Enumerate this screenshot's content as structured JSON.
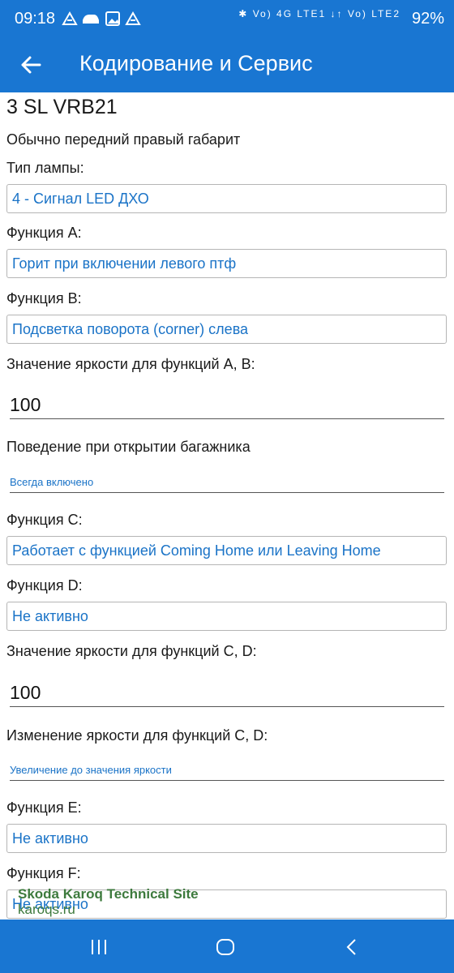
{
  "status_bar": {
    "time": "09:18",
    "left_icons": [
      "signal-app-icon",
      "car-icon",
      "image-icon",
      "signal-app-icon"
    ],
    "right_text": "Vo) 4G LTE1 ↓↑ Vo) LTE2",
    "battery": "92%"
  },
  "app_bar": {
    "title": "Кодирование и Сервис",
    "back_icon": "arrow-back-icon"
  },
  "main": {
    "heading": "3 SL VRB21",
    "subtitle": "Обычно передний правый габарит",
    "lamp_type_label": "Тип лампы:",
    "lamp_type_value": "4 - Сигнал LED ДХО",
    "func_a_label": "Функция A:",
    "func_a_value": "Горит при включении левого птф",
    "func_b_label": "Функция B:",
    "func_b_value": "Подсветка поворота (corner) слева",
    "brightness_ab_label": "Значение яркости для функций A, B:",
    "brightness_ab_value": "100",
    "trunk_label": "Поведение при открытии багажника",
    "trunk_value": "Всегда включено",
    "func_c_label": "Функция C:",
    "func_c_value": "Работает с функцией Coming Home или Leaving Home",
    "func_d_label": "Функция D:",
    "func_d_value": "Не активно",
    "brightness_cd_label": "Значение яркости для функций C, D:",
    "brightness_cd_value": "100",
    "brightness_change_label": "Изменение яркости для функций C, D:",
    "brightness_change_value": "Увеличение до значения яркости",
    "func_e_label": "Функция E:",
    "func_e_value": "Не активно",
    "func_f_label": "Функция F:",
    "func_f_value": "Не активно"
  },
  "watermark": {
    "line1": "Skoda Karoq Technical Site",
    "line2": "karoqs.ru"
  },
  "nav_bar": {
    "icons": [
      "recent-apps-icon",
      "home-icon",
      "back-icon"
    ]
  },
  "colors": {
    "primary": "#1976d2",
    "value_text": "#1a73c7",
    "watermark": "#3d7a3d"
  }
}
